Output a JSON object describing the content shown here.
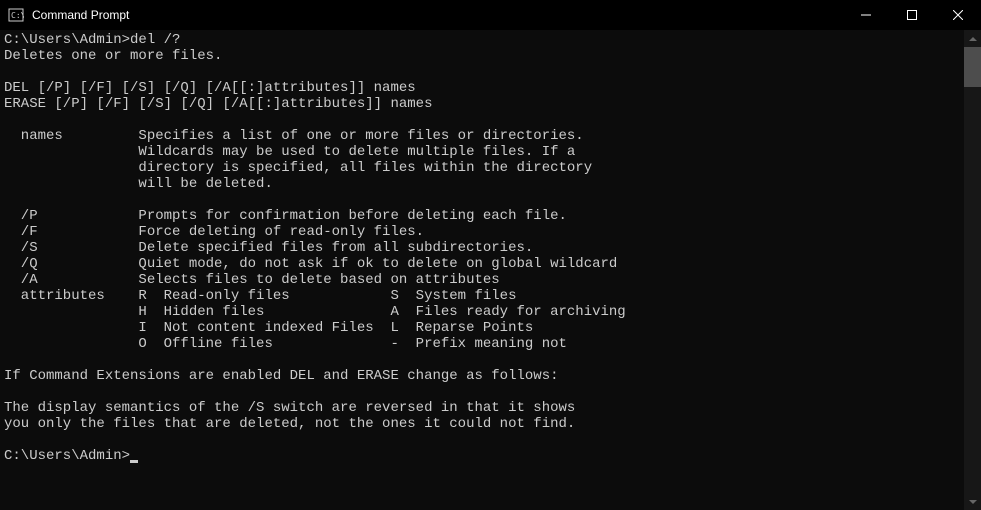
{
  "window": {
    "title": "Command Prompt"
  },
  "terminal": {
    "prompt1": "C:\\Users\\Admin>",
    "command": "del /?",
    "lines": [
      "Deletes one or more files.",
      "",
      "DEL [/P] [/F] [/S] [/Q] [/A[[:]attributes]] names",
      "ERASE [/P] [/F] [/S] [/Q] [/A[[:]attributes]] names",
      "",
      "  names         Specifies a list of one or more files or directories.",
      "                Wildcards may be used to delete multiple files. If a",
      "                directory is specified, all files within the directory",
      "                will be deleted.",
      "",
      "  /P            Prompts for confirmation before deleting each file.",
      "  /F            Force deleting of read-only files.",
      "  /S            Delete specified files from all subdirectories.",
      "  /Q            Quiet mode, do not ask if ok to delete on global wildcard",
      "  /A            Selects files to delete based on attributes",
      "  attributes    R  Read-only files            S  System files",
      "                H  Hidden files               A  Files ready for archiving",
      "                I  Not content indexed Files  L  Reparse Points",
      "                O  Offline files              -  Prefix meaning not",
      "",
      "If Command Extensions are enabled DEL and ERASE change as follows:",
      "",
      "The display semantics of the /S switch are reversed in that it shows",
      "you only the files that are deleted, not the ones it could not find.",
      ""
    ],
    "prompt2": "C:\\Users\\Admin>"
  }
}
